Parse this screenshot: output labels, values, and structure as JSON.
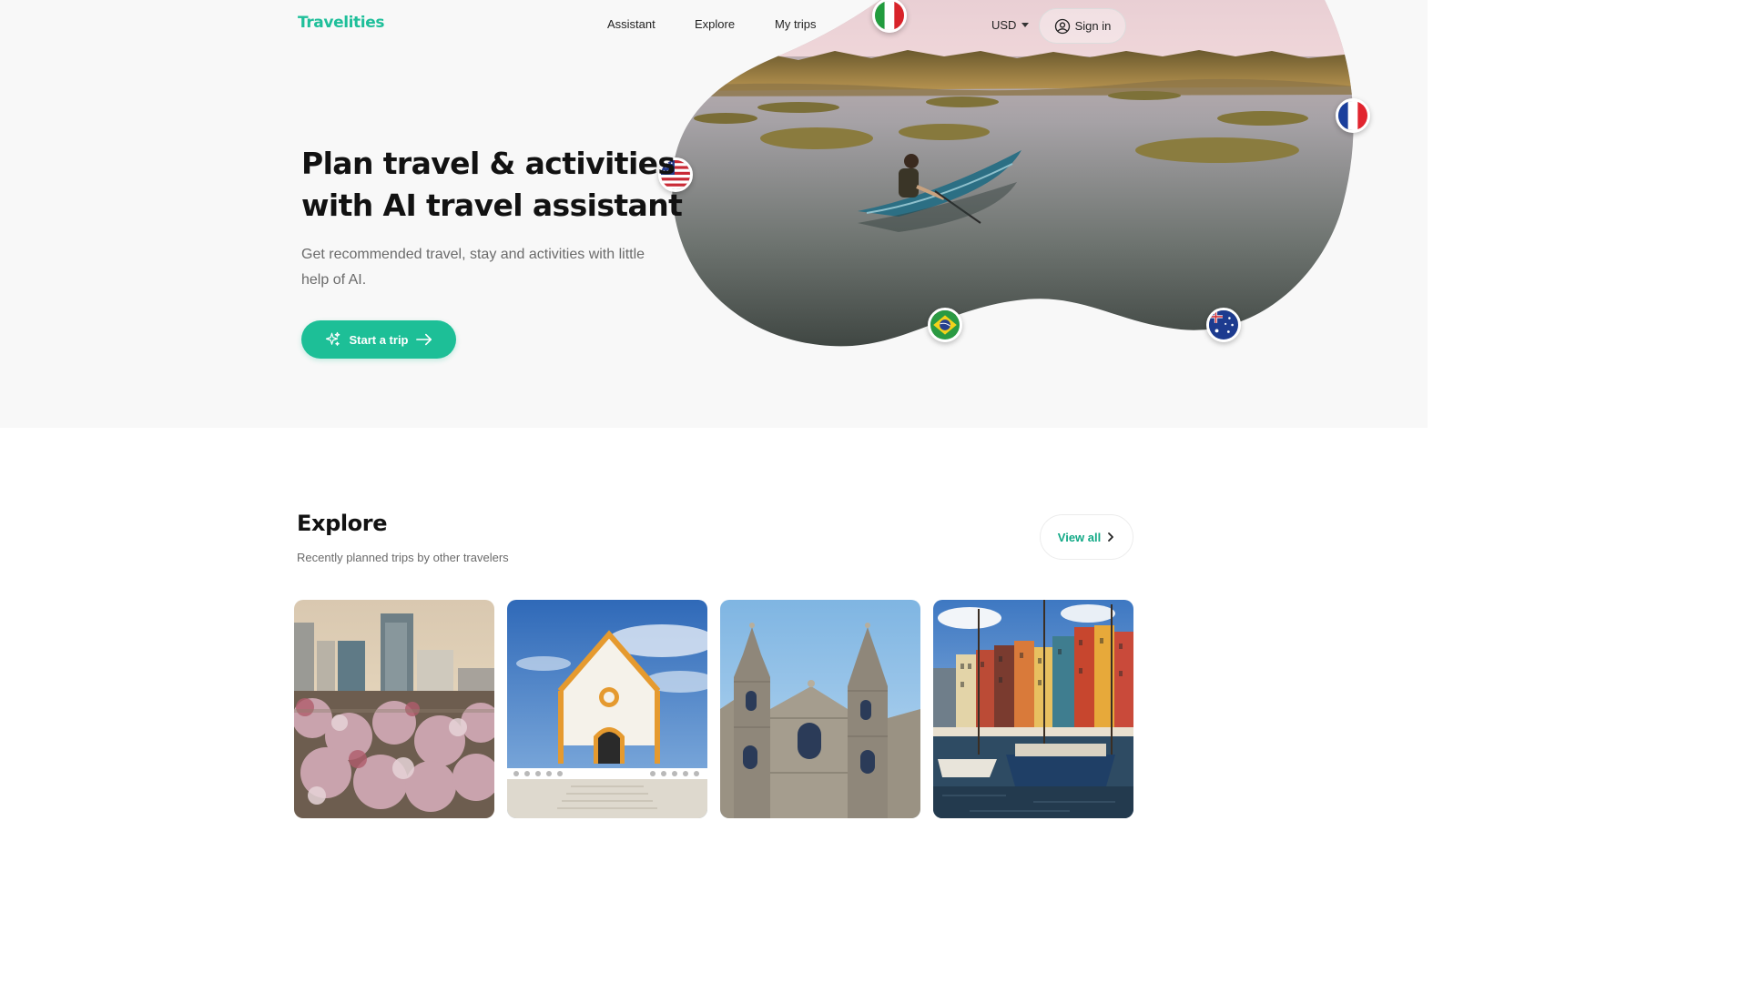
{
  "brand": {
    "name": "Travelities",
    "color": "#1fbf9a"
  },
  "nav": {
    "items": [
      {
        "label": "Assistant"
      },
      {
        "label": "Explore"
      },
      {
        "label": "My trips"
      }
    ]
  },
  "header": {
    "currency": "USD",
    "signin_label": "Sign in"
  },
  "hero": {
    "title": "Plan travel & activities with AI travel assistant",
    "subtitle": "Get recommended travel, stay and activities with little help of AI.",
    "cta_label": "Start a trip",
    "flags": [
      "italy-flag",
      "france-flag",
      "usa-flag",
      "brazil-flag",
      "australia-flag"
    ]
  },
  "explore": {
    "title": "Explore",
    "subtitle": "Recently planned trips by other travelers",
    "view_all_label": "View all",
    "cards": [
      "city-blossom-photo",
      "white-chapel-photo",
      "cathedral-photo",
      "harbor-houses-photo"
    ]
  },
  "colors": {
    "accent": "#1dbf97",
    "text": "#121212",
    "muted": "#6b6b6b",
    "hero_bg": "#f8f8f8"
  }
}
